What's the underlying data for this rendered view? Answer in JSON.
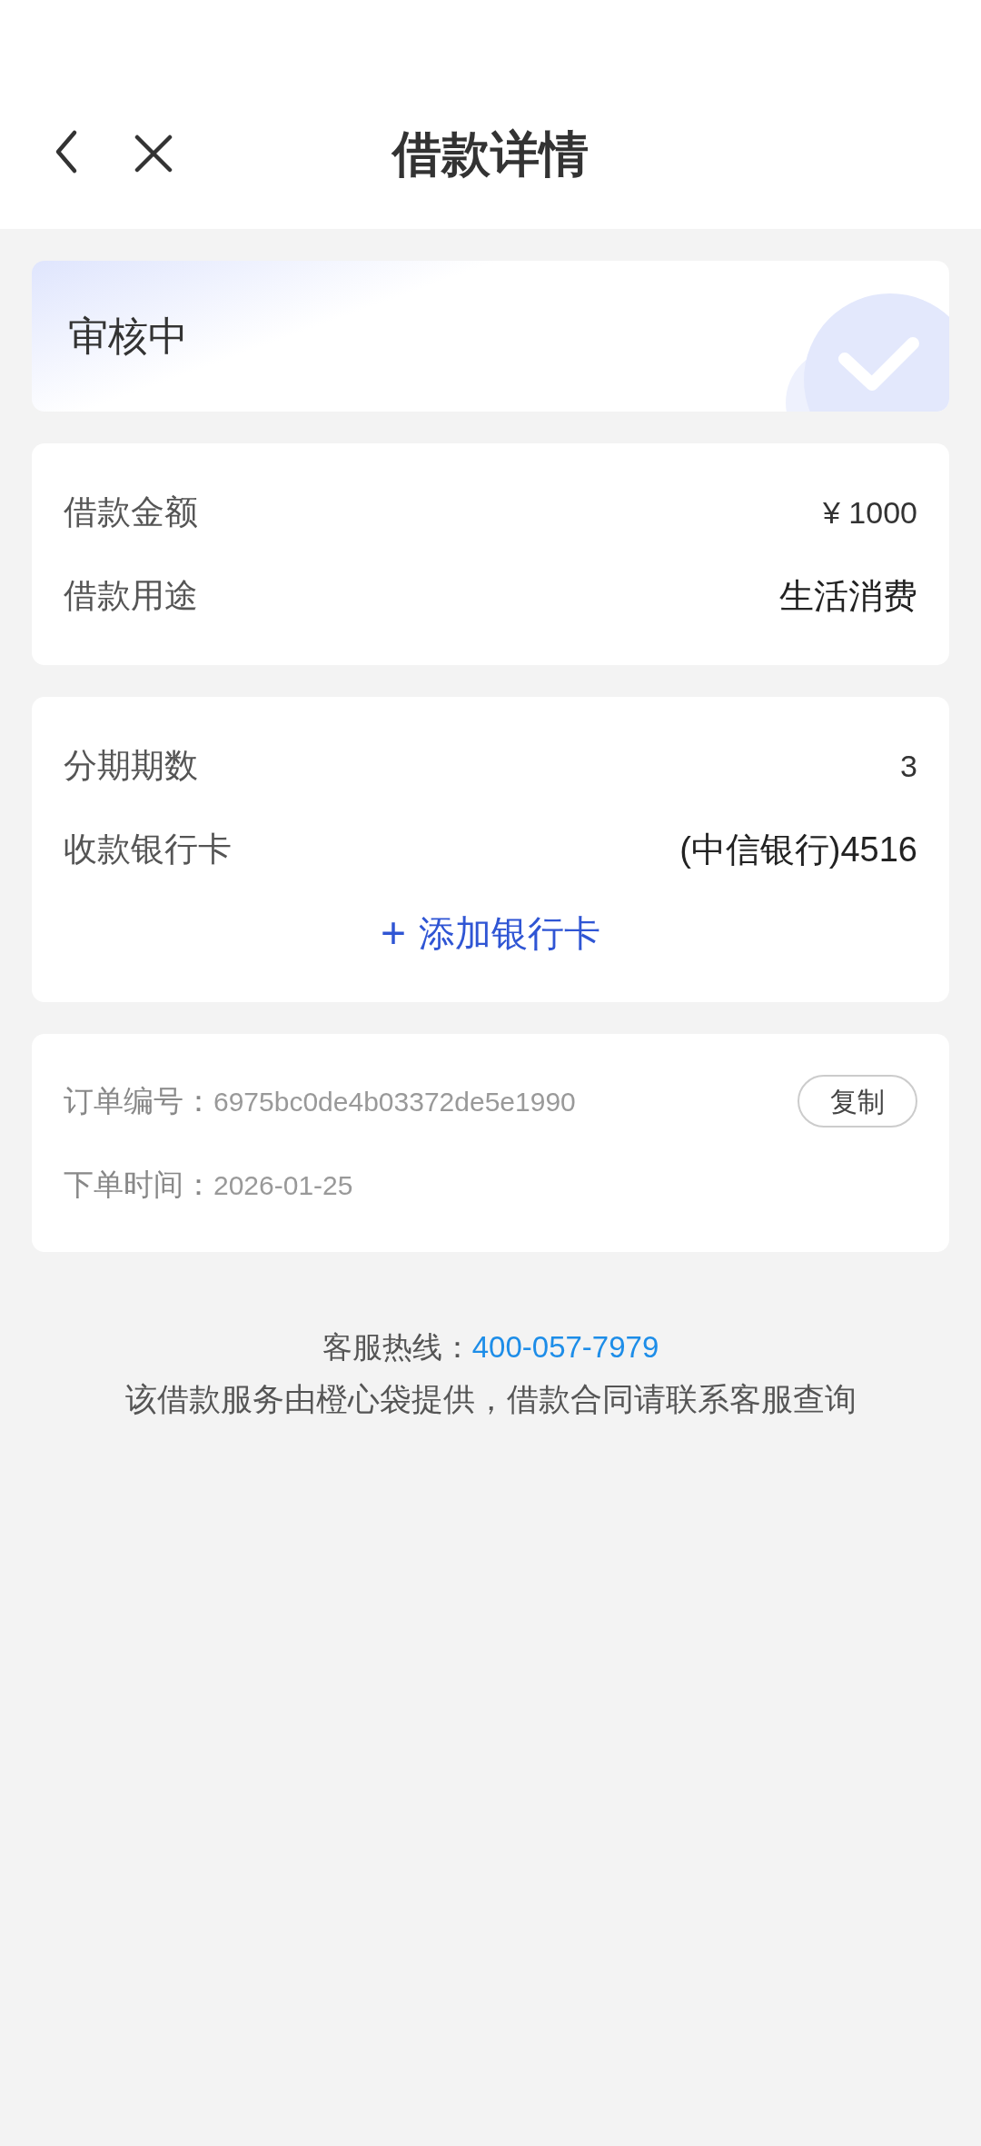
{
  "header": {
    "title": "借款详情"
  },
  "status": {
    "label": "审核中"
  },
  "loan_card": [
    {
      "label": "借款金额",
      "value": "¥ 1000",
      "kind": "plain"
    },
    {
      "label": "借款用途",
      "value": "生活消费",
      "kind": "strong"
    }
  ],
  "installment_card": {
    "rows": [
      {
        "label": "分期期数",
        "value": "3",
        "kind": "plain"
      },
      {
        "label": "收款银行卡",
        "value": "(中信银行)4516",
        "kind": "strong"
      }
    ],
    "add_card": {
      "icon": "+",
      "label": "添加银行卡"
    }
  },
  "order_card": {
    "rows": [
      {
        "label": "订单编号：",
        "value": "6975bc0de4b03372de5e1990",
        "action": "复制"
      },
      {
        "label": "下单时间：",
        "value": "2026-01-25"
      }
    ]
  },
  "footer": {
    "hotline_label": "客服热线：",
    "hotline": "400-057-7979",
    "note": "该借款服务由橙心袋提供，借款合同请联系客服查询"
  }
}
